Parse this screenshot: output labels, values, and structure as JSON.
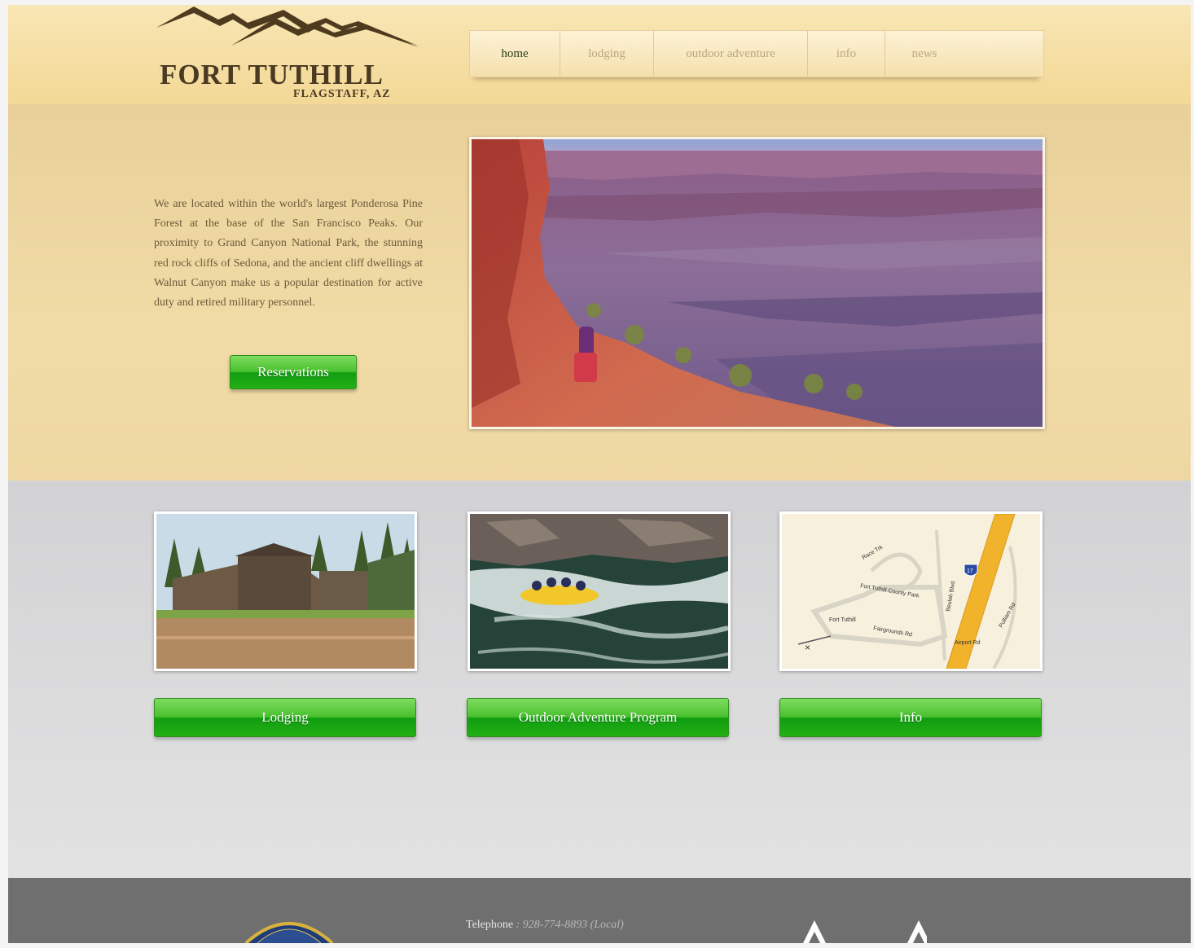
{
  "header": {
    "logo_title": "FORT TUTHILL",
    "logo_subtitle": "FLAGSTAFF, AZ",
    "nav": [
      {
        "label": "home",
        "active": true
      },
      {
        "label": "lodging",
        "active": false
      },
      {
        "label": "outdoor adventure",
        "active": false
      },
      {
        "label": "info",
        "active": false
      },
      {
        "label": "news",
        "active": false
      }
    ]
  },
  "hero": {
    "description": "We are located within the world's largest Ponderosa Pine Forest at the base of the San Francisco Peaks. Our proximity to Grand Canyon National Park, the stunning red rock cliffs of Sedona, and the ancient cliff dwellings at Walnut Canyon make us a popular destination for active duty and retired military personnel.",
    "reservations_label": "Reservations"
  },
  "features": [
    {
      "button_label": "Lodging"
    },
    {
      "button_label": "Outdoor Adventure Program"
    },
    {
      "button_label": "Info"
    }
  ],
  "map_labels": {
    "race_trk": "Race Trk",
    "county_park": "Fort Tuthill County Park",
    "fort_tuthill": "Fort Tuthill",
    "fairgrounds": "Fairgrounds Rd",
    "airport": "Airport Rd",
    "pulliam": "Pulliam Rd",
    "beulah": "Beulah Blvd",
    "highway": "17"
  },
  "footer": {
    "telephone_label": "Telephone",
    "telephone_number": ": 928-774-8893 (Local)"
  },
  "colors": {
    "header_bg": "#f5dea3",
    "hero_bg": "#eed6a0",
    "features_bg": "#d8d8d9",
    "footer_bg": "#6f6f70",
    "button_green": "#2fb11d",
    "logo_brown": "#4a3a22"
  }
}
